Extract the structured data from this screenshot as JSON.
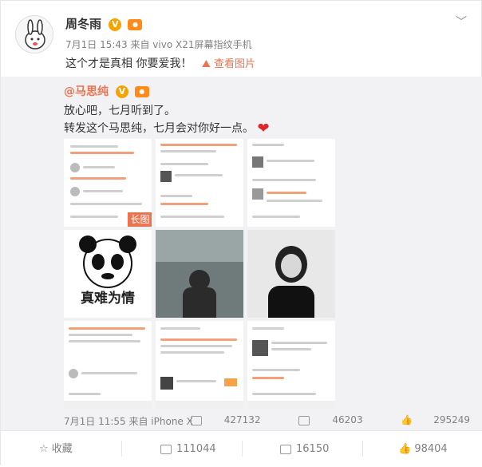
{
  "author": {
    "name": "周冬雨",
    "meta": "7月1日 15:43 来自 vivo X21屏幕指纹手机",
    "post_text": "这个才是真相 你要爱我！",
    "see_images": "查看图片"
  },
  "repost": {
    "author": "@马思纯",
    "line1": "放心吧，七月听到了。",
    "line2": "转发这个马思纯，七月会对你好一点。",
    "long_image_tag": "长图",
    "panda_caption": "真难为情",
    "meta": "7月1日 11:55 来自 iPhone X",
    "stats": {
      "reposts": "427132",
      "comments": "46203",
      "likes": "295249"
    }
  },
  "footer": {
    "favorite": "收藏",
    "repost_count": "111044",
    "comment_count": "16150",
    "like_count": "98404"
  },
  "colors": {
    "accent": "#eb7350",
    "heart": "#e0262d",
    "vip": "#f6a200"
  }
}
